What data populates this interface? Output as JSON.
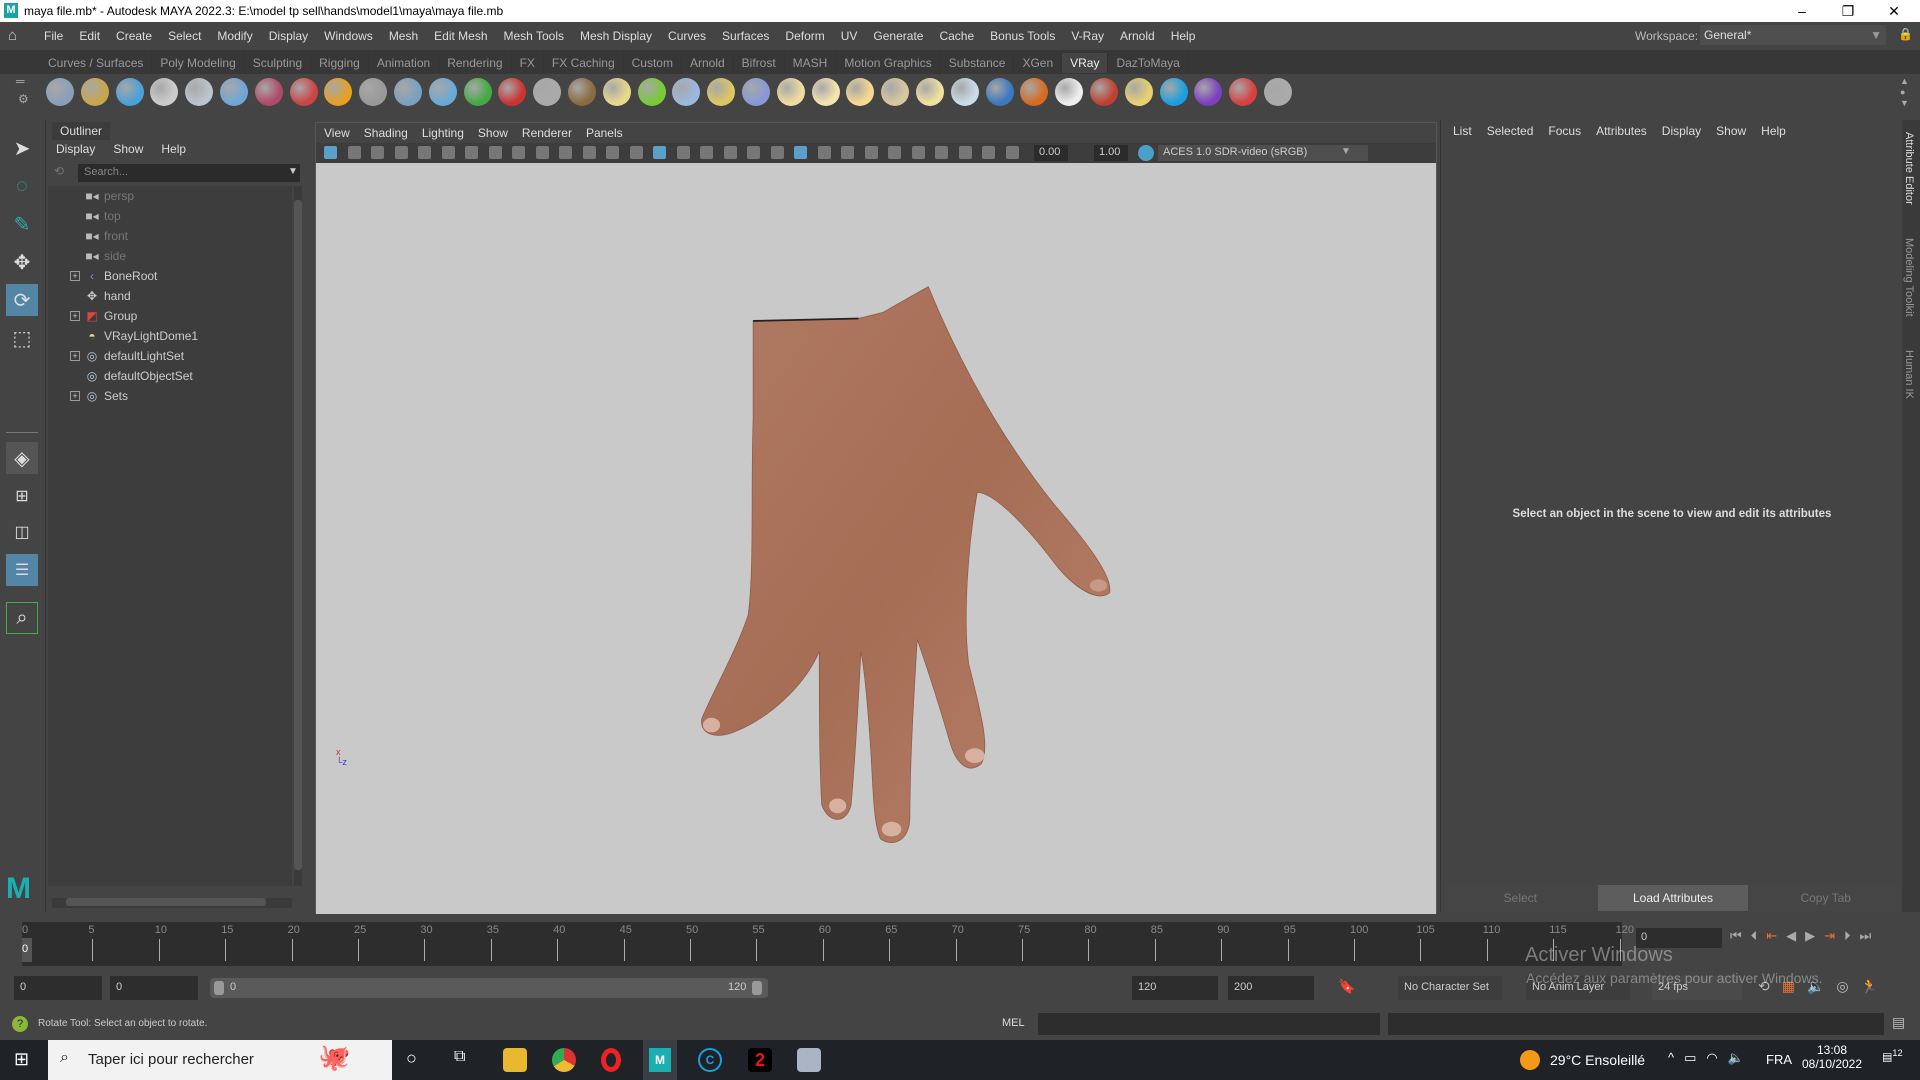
{
  "window": {
    "title": "maya file.mb* - Autodesk MAYA 2022.3: E:\\model tp sell\\hands\\model1\\maya\\maya file.mb",
    "logo": "M",
    "minimize": "–",
    "restore": "❐",
    "close": "✕"
  },
  "menubar": {
    "items": [
      "File",
      "Edit",
      "Create",
      "Select",
      "Modify",
      "Display",
      "Windows",
      "Mesh",
      "Edit Mesh",
      "Mesh Tools",
      "Mesh Display",
      "Curves",
      "Surfaces",
      "Deform",
      "UV",
      "Generate",
      "Cache",
      "Bonus Tools",
      "V-Ray",
      "Arnold",
      "Help"
    ],
    "workspace_label": "Workspace:",
    "workspace_value": "General*"
  },
  "shelf_tabs": [
    "Curves / Surfaces",
    "Poly Modeling",
    "Sculpting",
    "Rigging",
    "Animation",
    "Rendering",
    "FX",
    "FX Caching",
    "Custom",
    "Arnold",
    "Bifrost",
    "MASH",
    "Motion Graphics",
    "Substance",
    "XGen",
    "VRay",
    "DazToMaya"
  ],
  "shelf_active": "VRay",
  "shelf_icons": [
    {
      "name": "export-proxy-icon",
      "color": "#8aa0b8"
    },
    {
      "name": "import-proxy-icon",
      "color": "#c9a64a"
    },
    {
      "name": "object-properties-icon",
      "color": "#4aa0d8"
    },
    {
      "name": "plugin-icon",
      "color": "#ccc"
    },
    {
      "name": "frame-buffer-icon",
      "color": "#bcc4cc"
    },
    {
      "name": "sphere-light-icon",
      "color": "#6fa6d6"
    },
    {
      "name": "camera-icon",
      "color": "#b04a6a"
    },
    {
      "name": "materials-icon",
      "color": "#c44"
    },
    {
      "name": "fire-icon",
      "color": "#e8a020"
    },
    {
      "name": "mesh-light-icon",
      "color": "#999"
    },
    {
      "name": "rect-light-icon",
      "color": "#7aa0c0"
    },
    {
      "name": "cone-icon",
      "color": "#6aaad8"
    },
    {
      "name": "volume-icon",
      "color": "#4a4"
    },
    {
      "name": "shader-icon",
      "color": "#c33"
    },
    {
      "name": "texture-icon",
      "color": "#aaa"
    },
    {
      "name": "brick-icon",
      "color": "#8a6a40"
    },
    {
      "name": "globe-icon",
      "color": "#e8d88a"
    },
    {
      "name": "fur-icon",
      "color": "#7c3"
    },
    {
      "name": "cluster-icon",
      "color": "#9ab8e0"
    },
    {
      "name": "spline-icon",
      "color": "#dcc860"
    },
    {
      "name": "dome-sphere-icon",
      "color": "#8898d8"
    },
    {
      "name": "dome-light-icon",
      "color": "#f0dca0"
    },
    {
      "name": "spot-light-icon",
      "color": "#f4e4b0"
    },
    {
      "name": "sphere-glow-icon",
      "color": "#f6d890"
    },
    {
      "name": "ies-light-icon",
      "color": "#d8c8a0"
    },
    {
      "name": "sun-icon",
      "color": "#f0e0a0"
    },
    {
      "name": "plane-icon",
      "color": "#c8dce8"
    },
    {
      "name": "blue-sphere-icon",
      "color": "#3a78c0"
    },
    {
      "name": "toon-icon",
      "color": "#d86a20"
    },
    {
      "name": "checker-icon",
      "color": "#eee"
    },
    {
      "name": "vfb-icon",
      "color": "#c04030"
    },
    {
      "name": "light-lister-icon",
      "color": "#e8d070"
    },
    {
      "name": "vray-cloud-icon",
      "color": "#1aa0e0"
    },
    {
      "name": "chaos-icon",
      "color": "#7a40c0"
    },
    {
      "name": "color-balls-icon",
      "color": "#d84040"
    },
    {
      "name": "help-icon",
      "color": "#aaa"
    }
  ],
  "outliner": {
    "tab": "Outliner",
    "menu": [
      "Display",
      "Show",
      "Help"
    ],
    "search_placeholder": "Search...",
    "items": [
      {
        "label": "persp",
        "icon": "camera-icon",
        "dim": true,
        "expandable": false
      },
      {
        "label": "top",
        "icon": "camera-icon",
        "dim": true,
        "expandable": false
      },
      {
        "label": "front",
        "icon": "camera-icon",
        "dim": true,
        "expandable": false
      },
      {
        "label": "side",
        "icon": "camera-icon",
        "dim": true,
        "expandable": false
      },
      {
        "label": "BoneRoot",
        "icon": "joint-icon",
        "dim": false,
        "expandable": true
      },
      {
        "label": "hand",
        "icon": "mesh-icon",
        "dim": false,
        "expandable": false
      },
      {
        "label": "Group",
        "icon": "group-icon",
        "dim": false,
        "expandable": true
      },
      {
        "label": "VRayLightDome1",
        "icon": "dome-light-icon",
        "dim": false,
        "expandable": false
      },
      {
        "label": "defaultLightSet",
        "icon": "set-icon",
        "dim": false,
        "expandable": true
      },
      {
        "label": "defaultObjectSet",
        "icon": "set-icon",
        "dim": false,
        "expandable": false
      },
      {
        "label": "Sets",
        "icon": "set-icon",
        "dim": false,
        "expandable": true
      }
    ]
  },
  "viewport": {
    "menu": [
      "View",
      "Shading",
      "Lighting",
      "Show",
      "Renderer",
      "Panels"
    ],
    "exposure": "0.00",
    "gamma": "1.00",
    "color_space": "ACES 1.0 SDR-video (sRGB)"
  },
  "attribute_editor": {
    "menu": [
      "List",
      "Selected",
      "Focus",
      "Attributes",
      "Display",
      "Show",
      "Help"
    ],
    "message": "Select an object in the scene to view and edit its attributes",
    "buttons": [
      "Select",
      "Load Attributes",
      "Copy Tab"
    ]
  },
  "side_tabs": [
    "Attribute Editor",
    "Modeling Toolkit",
    "Human IK"
  ],
  "timeline": {
    "ticks": [
      0,
      5,
      10,
      15,
      20,
      25,
      30,
      35,
      40,
      45,
      50,
      55,
      60,
      65,
      70,
      75,
      80,
      85,
      90,
      95,
      100,
      105,
      110,
      115,
      120
    ],
    "current_frame": "0",
    "current_frame_field": "0"
  },
  "range": {
    "start": "0",
    "anim_start": "0",
    "range_start": "0",
    "range_end": "120",
    "end": "120",
    "anim_end": "200",
    "character_set": "No Character Set",
    "anim_layer": "No Anim Layer",
    "fps": "24 fps"
  },
  "command": {
    "lang": "MEL",
    "help_text": "Rotate Tool: Select an object to rotate."
  },
  "watermark": {
    "title": "Activer Windows",
    "subtitle": "Accédez aux paramètres pour activer Windows."
  },
  "taskbar": {
    "search_placeholder": "Taper ici pour rechercher",
    "weather": "29°C  Ensoleillé",
    "lang": "FRA",
    "time": "13:08",
    "date": "08/10/2022",
    "notifications": "12"
  }
}
